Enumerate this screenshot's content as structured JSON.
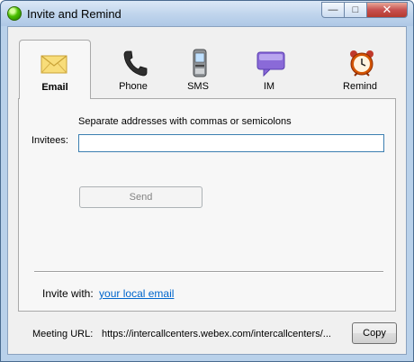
{
  "window": {
    "title": "Invite and Remind",
    "controls": {
      "minimize": "—",
      "maximize": "□",
      "close": "✕"
    }
  },
  "tabs": [
    {
      "label": "Email",
      "icon": "envelope-icon",
      "active": true
    },
    {
      "label": "Phone",
      "icon": "phone-icon",
      "active": false
    },
    {
      "label": "SMS",
      "icon": "mobile-phone-icon",
      "active": false
    },
    {
      "label": "IM",
      "icon": "chat-bubble-icon",
      "active": false
    },
    {
      "label": "Remind",
      "icon": "alarm-clock-icon",
      "active": false
    }
  ],
  "email": {
    "hint": "Separate addresses with commas or semicolons",
    "invitees_label": "Invitees:",
    "invitees_value": "",
    "send_label": "Send",
    "invite_with_label": "Invite with:",
    "invite_with_link": "your local email"
  },
  "footer": {
    "meeting_url_label": "Meeting URL:",
    "meeting_url_value": "https://intercallcenters.webex.com/intercallcenters/...",
    "copy_label": "Copy"
  },
  "colors": {
    "titlebar": "#bfd4ec",
    "close_button": "#c75050",
    "link": "#0066cc",
    "input_border": "#3c7fb1"
  }
}
